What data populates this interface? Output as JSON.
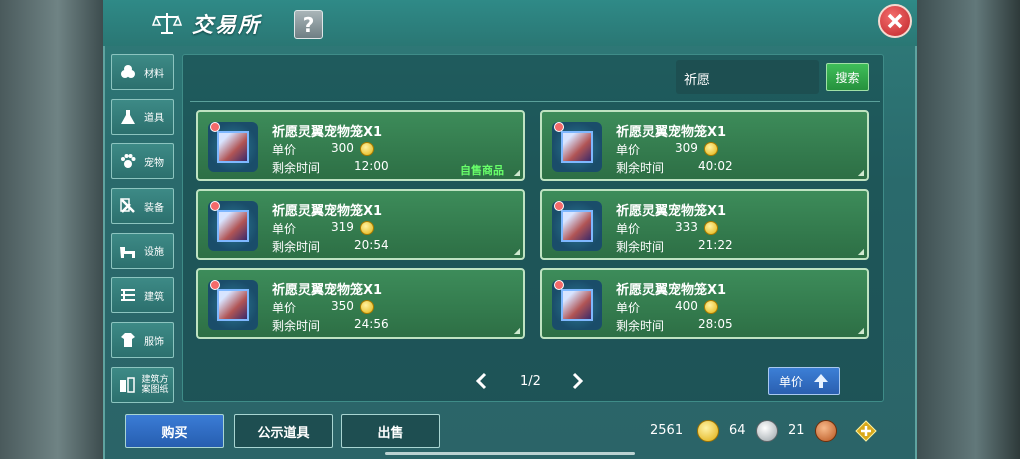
{
  "header": {
    "title": "交易所",
    "help_label": "?"
  },
  "sidebar": {
    "items": [
      {
        "label": "材料",
        "icon": "materials-icon"
      },
      {
        "label": "道具",
        "icon": "flask-icon"
      },
      {
        "label": "宠物",
        "icon": "paw-icon"
      },
      {
        "label": "装备",
        "icon": "equipment-icon"
      },
      {
        "label": "设施",
        "icon": "facility-icon"
      },
      {
        "label": "建筑",
        "icon": "building-icon"
      },
      {
        "label": "服饰",
        "icon": "clothing-icon"
      },
      {
        "label": "建筑方案图纸",
        "icon": "blueprint-icon"
      }
    ]
  },
  "search": {
    "value": "祈愿",
    "button_label": "搜索"
  },
  "listings": [
    {
      "name": "祈愿灵翼宠物笼X1",
      "price_label": "单价",
      "price": "300",
      "time_label": "剩余时间",
      "time": "12:00",
      "own_label": "自售商品"
    },
    {
      "name": "祈愿灵翼宠物笼X1",
      "price_label": "单价",
      "price": "309",
      "time_label": "剩余时间",
      "time": "40:02"
    },
    {
      "name": "祈愿灵翼宠物笼X1",
      "price_label": "单价",
      "price": "319",
      "time_label": "剩余时间",
      "time": "20:54"
    },
    {
      "name": "祈愿灵翼宠物笼X1",
      "price_label": "单价",
      "price": "333",
      "time_label": "剩余时间",
      "time": "21:22"
    },
    {
      "name": "祈愿灵翼宠物笼X1",
      "price_label": "单价",
      "price": "350",
      "time_label": "剩余时间",
      "time": "24:56"
    },
    {
      "name": "祈愿灵翼宠物笼X1",
      "price_label": "单价",
      "price": "400",
      "time_label": "剩余时间",
      "time": "28:05"
    }
  ],
  "pager": {
    "text": "1/2"
  },
  "sort": {
    "label": "单价"
  },
  "actions": {
    "buy": "购买",
    "show": "公示道具",
    "sell": "出售"
  },
  "currency": {
    "gold": "2561",
    "silver": "64",
    "copper": "21"
  },
  "colors": {
    "panel": "#2a6a6c",
    "card": "#2d6f45",
    "buy_button": "#3b7cd6",
    "own_tag": "#68ff6a"
  }
}
